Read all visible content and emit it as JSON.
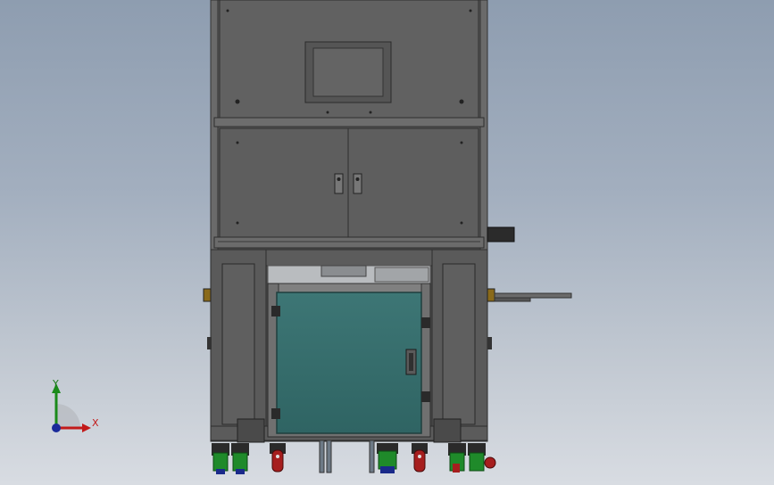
{
  "viewport": {
    "name": "cad-model-viewport"
  },
  "triad": {
    "y_label": "Y",
    "x_label": "X"
  },
  "colors": {
    "frame": "#5f5f5f",
    "frame_dark": "#3a3a3a",
    "panel": "#666666",
    "door": "#336b6a",
    "caster_green": "#1f8a2a",
    "caster_red": "#a61e1e",
    "caster_blue": "#1a2a8a"
  }
}
